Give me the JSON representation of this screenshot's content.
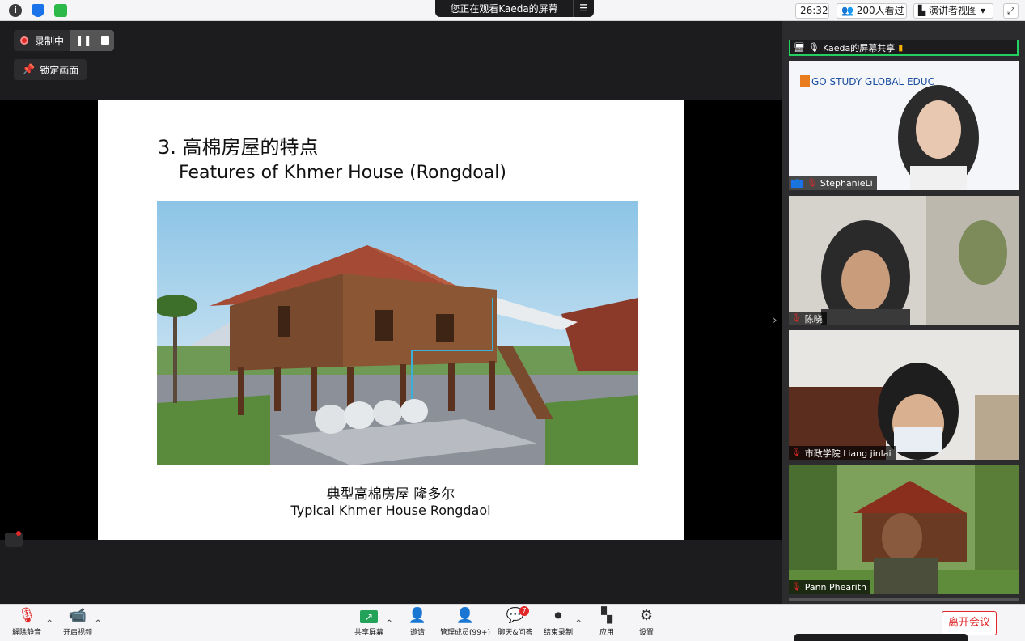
{
  "topbar": {
    "banner_text": "您正在观看Kaeda的屏幕",
    "banner_menu_icon": "menu-icon",
    "timer": "26:32",
    "viewers": "200人看过",
    "view_mode": "演讲者视图",
    "icons": [
      "info-icon",
      "shield-icon",
      "signal-icon",
      "fullscreen-icon"
    ]
  },
  "recording": {
    "status": "录制中",
    "pause_icon": "pause-icon",
    "stop_icon": "stop-icon"
  },
  "lock_screen": {
    "label": "锁定画面",
    "icon": "pin-icon"
  },
  "slide": {
    "title": "3. 高棉房屋的特点",
    "subtitle": "Features of Khmer House (Rongdoal)",
    "caption_cn": "典型高棉房屋 隆多尔",
    "caption_en": "Typical Khmer House Rongdaol"
  },
  "gallery": {
    "share_label": "Kaeda的屏幕共享",
    "tiles": [
      {
        "name": "StephanieLi",
        "logo_text": "GO STUDY GLOBAL EDUC"
      },
      {
        "name": "陈晓"
      },
      {
        "name": "市政学院 Liang jinlai"
      },
      {
        "name": "Pann Phearith"
      }
    ]
  },
  "toolbar": {
    "unmute": "解除静音",
    "video": "开启视频",
    "share_screen": "共享屏幕",
    "invite": "邀请",
    "participants": "管理成员(99+)",
    "chat": "聊天&问答",
    "chat_badge": "7",
    "end_record": "结束录制",
    "apps": "应用",
    "settings": "设置",
    "leave": "离开会议"
  },
  "colors": {
    "accent_green": "#23d160",
    "danger_red": "#e02828",
    "share_green": "#23a35a"
  }
}
